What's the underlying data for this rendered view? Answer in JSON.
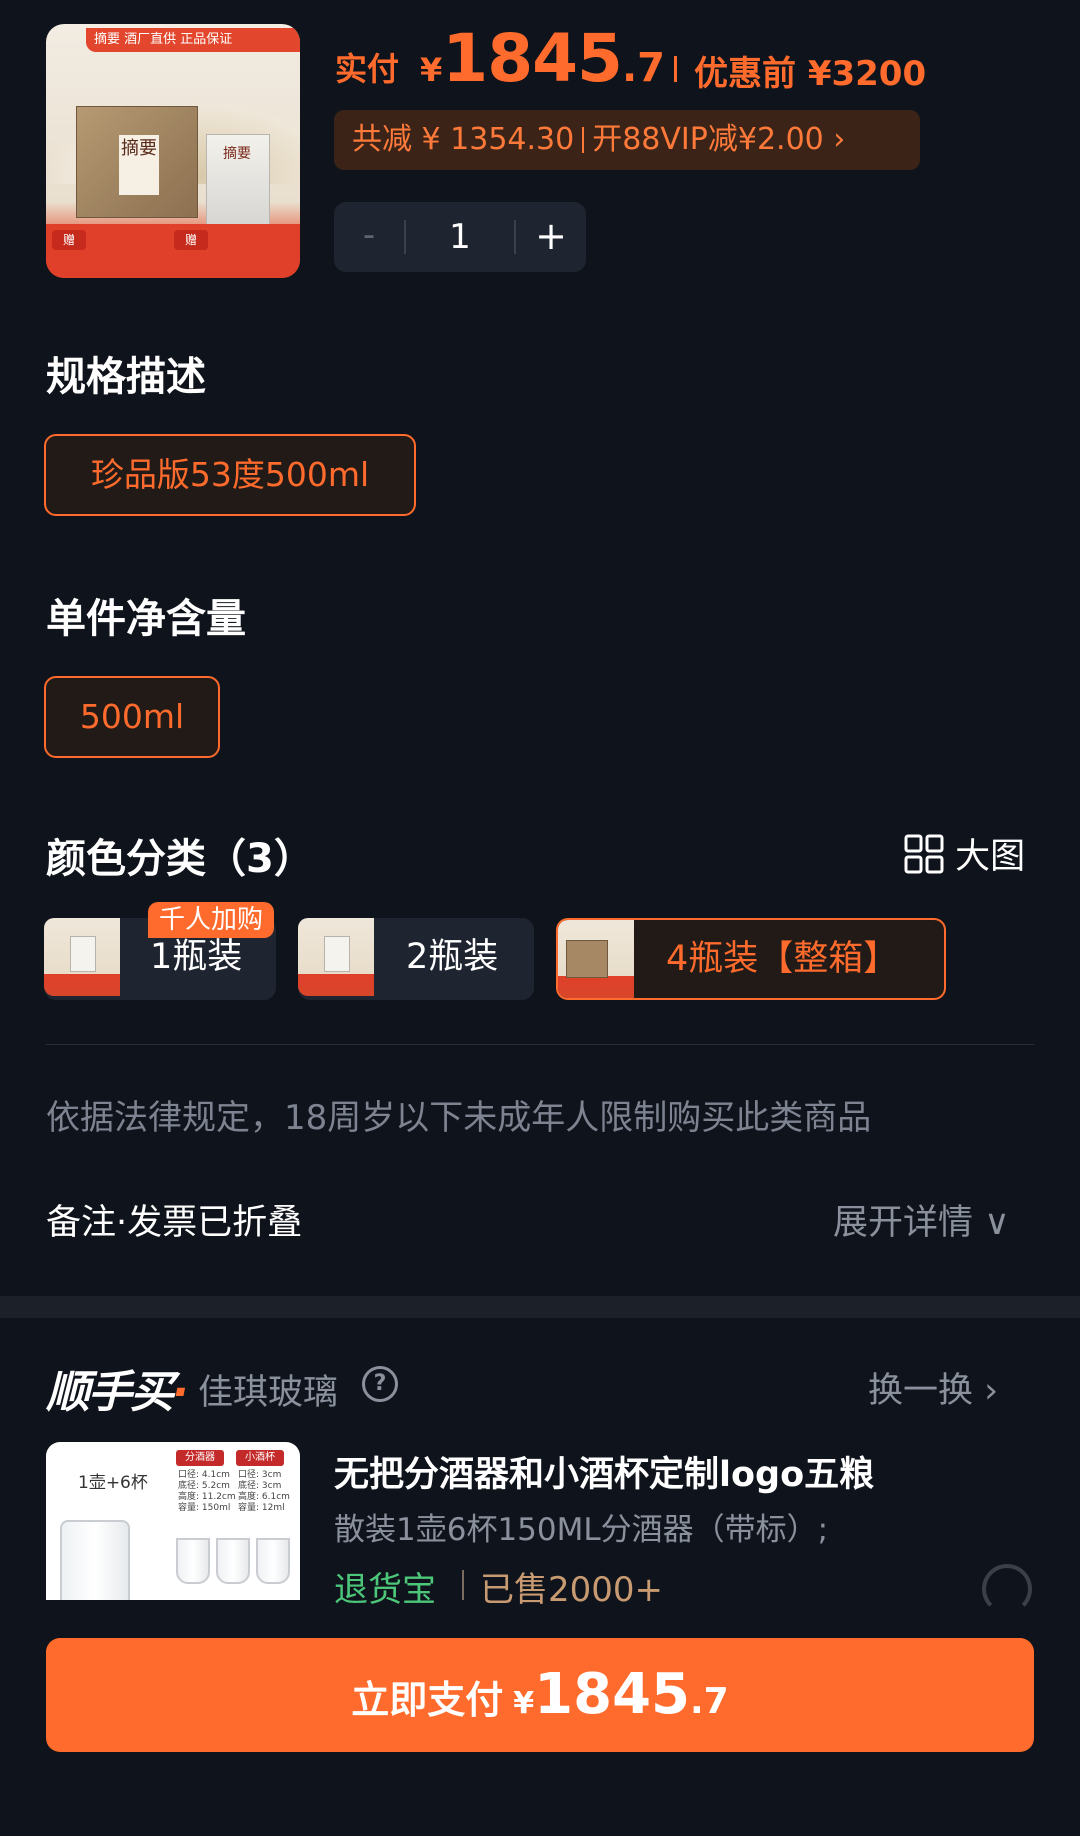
{
  "product": {
    "image_alt": "摘要 product box and bottle",
    "image_banner": "摘要 酒厂直供 正品保证",
    "box_label": "摘要",
    "gift_label": "赠"
  },
  "price": {
    "paid_label": "实付",
    "currency": "¥",
    "paid_integer": "1845",
    "paid_decimal": ".7",
    "original_label": "优惠前 ¥3200",
    "savings_text": "共减 ¥ 1354.30",
    "vip_text": "开88VIP减¥2.00 ›"
  },
  "quantity": {
    "minus": "-",
    "value": "1",
    "plus": "+"
  },
  "spec": {
    "title": "规格描述",
    "selected": "珍品版53度500ml"
  },
  "volume": {
    "title": "单件净含量",
    "selected": "500ml"
  },
  "color": {
    "title": "颜色分类（3）",
    "view_toggle": "大图",
    "hot_badge": "千人加购",
    "options": [
      {
        "label": "1瓶装"
      },
      {
        "label": "2瓶装"
      },
      {
        "label": "4瓶装【整箱】"
      }
    ],
    "selected_index": 2
  },
  "notice": "依据法律规定，18周岁以下未成年人限制购买此类商品",
  "remark": {
    "label": "备注·发票已折叠",
    "expand": "展开详情 ∨"
  },
  "recommend": {
    "logo": "顺手买",
    "logo_dot": "·",
    "shop": "佳琪玻璃",
    "help": "?",
    "swap": "换一换 ›",
    "item": {
      "image_text": "1壶+6杯",
      "image_tag1": "分酒器",
      "image_tag2": "小酒杯",
      "image_spec1": "口径: 4.1cm\n底径: 5.2cm\n高度: 11.2cm\n容量: 150ml",
      "image_spec2": "口径: 3cm\n底径: 3cm\n高度: 6.1cm\n容量: 12ml",
      "title": "无把分酒器和小酒杯定制logo五粮",
      "subtitle": "散装1壶6杯150ML分酒器（带标）;",
      "tag": "退货宝",
      "sold": "已售2000+"
    }
  },
  "pay_button": {
    "label": "立即支付",
    "currency": "¥",
    "integer": "1845",
    "decimal": ".7"
  },
  "colors": {
    "background": "#0f131b",
    "accent": "#ff6b2c",
    "muted": "#8a909c",
    "green": "#4cc77a"
  }
}
